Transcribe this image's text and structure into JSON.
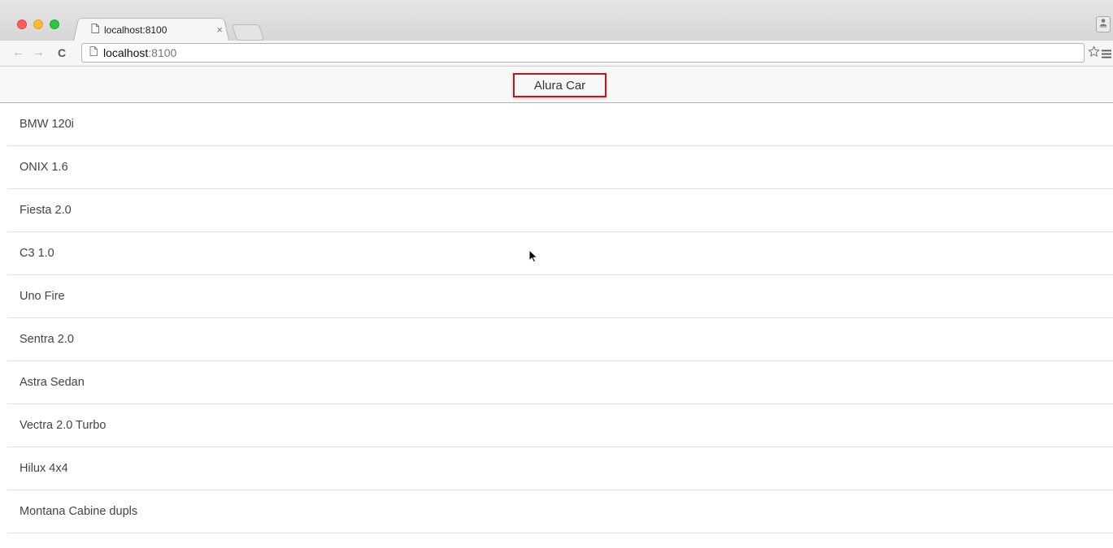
{
  "browser": {
    "tab": {
      "title": "localhost:8100",
      "close_glyph": "×",
      "icon": "page-icon"
    },
    "address_bar": {
      "host": "localhost",
      "port": ":8100"
    },
    "nav": {
      "back_glyph": "←",
      "forward_glyph": "→",
      "reload_glyph": "C"
    },
    "icons": [
      "page-icon",
      "star-icon",
      "menu-icon",
      "profile-icon"
    ]
  },
  "app": {
    "title": "Alura Car",
    "title_highlight_color": "#b71c1c"
  },
  "cars": [
    {
      "name": "BMW 120i"
    },
    {
      "name": "ONIX 1.6"
    },
    {
      "name": "Fiesta 2.0"
    },
    {
      "name": "C3 1.0"
    },
    {
      "name": "Uno Fire"
    },
    {
      "name": "Sentra 2.0"
    },
    {
      "name": "Astra Sedan"
    },
    {
      "name": "Vectra 2.0 Turbo"
    },
    {
      "name": "Hilux 4x4"
    },
    {
      "name": "Montana Cabine dupls"
    }
  ]
}
